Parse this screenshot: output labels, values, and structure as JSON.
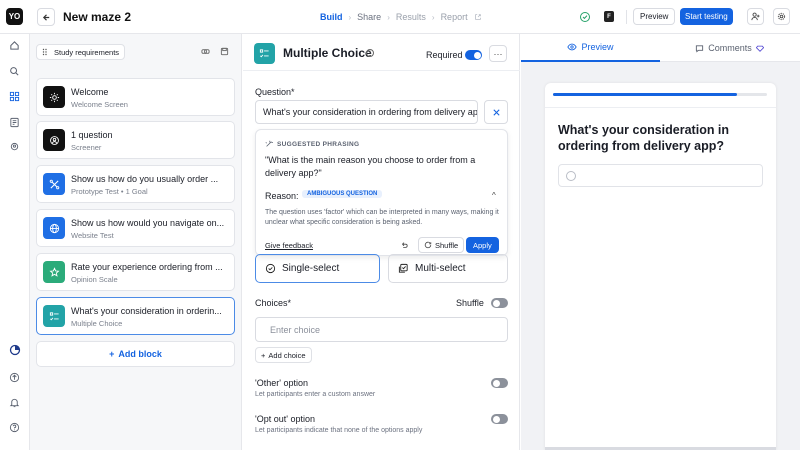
{
  "app": {
    "logo_text": "YO",
    "project_title": "New maze 2"
  },
  "steps": [
    {
      "label": "Build",
      "state": "active"
    },
    {
      "label": "Share",
      "state": "enabled"
    },
    {
      "label": "Results",
      "state": "disabled"
    },
    {
      "label": "Report",
      "state": "disabled"
    }
  ],
  "topbar": {
    "preview_label": "Preview",
    "start_label": "Start testing",
    "f_badge": "F"
  },
  "sidebar": {
    "study_requirements": "Study requirements"
  },
  "blocks": [
    {
      "title": "Welcome",
      "subtitle": "Welcome Screen",
      "icon": "sun-icon",
      "color": "#111111"
    },
    {
      "title": "1 question",
      "subtitle": "Screener",
      "icon": "screener-icon",
      "color": "#111111"
    },
    {
      "title": "Show us how do you usually order ...",
      "subtitle": "Prototype Test • 1 Goal",
      "icon": "prototype-icon",
      "color": "#1f6fe5"
    },
    {
      "title": "Show us how would you navigate on...",
      "subtitle": "Website Test",
      "icon": "globe-icon",
      "color": "#1f6fe5"
    },
    {
      "title": "Rate your experience ordering from ...",
      "subtitle": "Opinion Scale",
      "icon": "star-icon",
      "color": "#2bab7a"
    },
    {
      "title": "What's your consideration in orderin...",
      "subtitle": "Multiple Choice",
      "icon": "list-icon",
      "color": "#22a3a7"
    }
  ],
  "add_block_label": "Add block",
  "editor": {
    "title": "Multiple Choice",
    "required_label": "Required",
    "question_label": "Question*",
    "question_value": "What's your consideration in ordering from delivery app?",
    "suggestion": {
      "heading": "SUGGESTED PHRASING",
      "text": "\"What is the main reason you choose to order from a delivery app?\"",
      "reason_label": "Reason:",
      "reason_badge": "AMBIGUOUS QUESTION",
      "explanation": "The question uses 'factor' which can be interpreted in many ways, making it unclear what specific consideration is being asked.",
      "feedback_label": "Give feedback",
      "shuffle_label": "Shuffle",
      "apply_label": "Apply"
    },
    "single_select": "Single-select",
    "multi_select": "Multi-select",
    "choices_label": "Choices*",
    "shuffle_label": "Shuffle",
    "choice_placeholder": "Enter choice",
    "add_choice_label": "Add choice",
    "other_option": {
      "title": "'Other' option",
      "subtitle": "Let participants enter a custom answer"
    },
    "optout_option": {
      "title": "'Opt out' option",
      "subtitle": "Let participants indicate that none of the options apply"
    }
  },
  "preview": {
    "tab_preview": "Preview",
    "tab_comments": "Comments",
    "question": "What's your consideration in ordering from delivery app?",
    "progress": 0.86
  },
  "colors": {
    "accent": "#1463e0",
    "mc_teal": "#22a3a7"
  }
}
